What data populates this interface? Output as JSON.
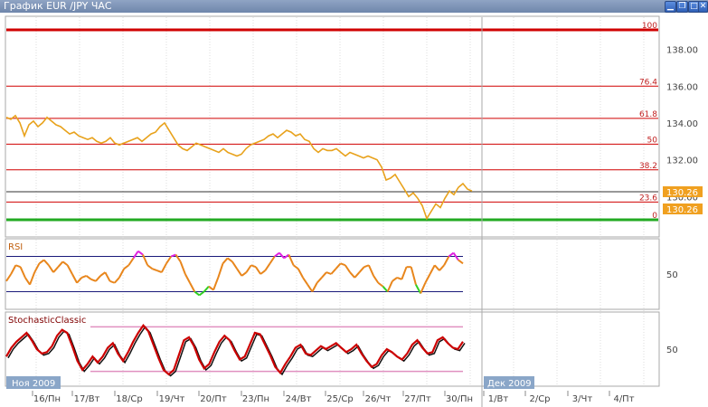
{
  "window": {
    "title": "График EUR /JPY  ЧАС",
    "buttons": [
      "minimize",
      "restore",
      "maximize",
      "close"
    ]
  },
  "colors": {
    "price_line": "#e8a21c",
    "fib_line": "#d00000",
    "fib_label": "#c02020",
    "current_price_bg": "#f0a020",
    "low_line": "#22aa22",
    "rsi_normal": "#e8861c",
    "rsi_overbought": "#e020e0",
    "rsi_oversold": "#30d020",
    "stoch_main": "#cc0000",
    "stoch_signal": "#111111",
    "stoch_band": "#e090c0",
    "rsi_band": "#1a1a7a",
    "grid": "#dddddd",
    "date_box": "#8aa6c8"
  },
  "chart_data": [
    {
      "type": "line",
      "panel": "price",
      "title": "",
      "x": [
        0,
        5,
        10,
        15,
        20,
        25,
        30,
        35,
        40,
        45,
        50,
        55,
        60,
        65,
        70,
        75,
        80,
        85,
        90,
        95,
        100,
        105,
        110,
        115,
        120,
        125,
        130,
        135,
        140,
        145,
        150,
        155,
        160,
        165,
        170,
        175,
        180,
        185,
        190,
        195,
        200,
        205,
        210,
        215,
        220,
        225,
        230,
        235,
        240,
        245,
        250,
        255,
        260,
        265,
        270,
        275,
        280,
        285,
        290,
        295,
        300,
        305,
        310,
        315,
        320,
        325,
        330,
        335,
        340,
        345,
        350,
        355,
        360,
        365,
        370,
        375,
        380,
        385,
        390,
        395,
        400,
        405,
        410,
        415,
        420,
        425,
        430,
        435,
        440,
        445,
        450,
        455,
        460,
        465,
        470,
        475,
        480,
        485,
        490,
        495,
        500,
        505,
        510,
        515
      ],
      "y": [
        134.3,
        134.2,
        134.4,
        134.0,
        133.3,
        133.9,
        134.1,
        133.8,
        134.0,
        134.3,
        134.1,
        133.9,
        133.8,
        133.6,
        133.4,
        133.5,
        133.3,
        133.2,
        133.1,
        133.2,
        133.0,
        132.9,
        133.0,
        133.2,
        132.9,
        132.8,
        132.9,
        133.0,
        133.1,
        133.2,
        133.0,
        133.2,
        133.4,
        133.5,
        133.8,
        134.0,
        133.6,
        133.2,
        132.8,
        132.6,
        132.5,
        132.7,
        132.9,
        132.8,
        132.7,
        132.6,
        132.5,
        132.4,
        132.6,
        132.4,
        132.3,
        132.2,
        132.3,
        132.6,
        132.8,
        132.9,
        133.0,
        133.1,
        133.3,
        133.4,
        133.2,
        133.4,
        133.6,
        133.5,
        133.3,
        133.4,
        133.1,
        133.0,
        132.6,
        132.4,
        132.6,
        132.5,
        132.5,
        132.6,
        132.4,
        132.2,
        132.4,
        132.3,
        132.2,
        132.1,
        132.2,
        132.1,
        132.0,
        131.6,
        130.9,
        131.0,
        131.2,
        130.8,
        130.4,
        130.0,
        130.2,
        129.9,
        129.5,
        128.8,
        129.2,
        129.6,
        129.4,
        129.9,
        130.3,
        130.1,
        130.5,
        130.7,
        130.4,
        130.3
      ],
      "ylim": [
        127.8,
        139.8
      ],
      "y_ticks": [
        "138.00",
        "136.00",
        "134.00",
        "132.00",
        "130.00"
      ],
      "fib_levels": [
        {
          "label": "100",
          "value": 138.85
        },
        {
          "label": "76.4",
          "value": 136.0
        },
        {
          "label": "61.8",
          "value": 134.25
        },
        {
          "label": "50",
          "value": 132.85
        },
        {
          "label": "38.2",
          "value": 131.45
        },
        {
          "label": "23.6",
          "value": 129.7
        },
        {
          "label": "0",
          "value": 126.85
        }
      ],
      "current_price": "130.26",
      "current_price_value": 130.26,
      "low_price_label": "130.26"
    },
    {
      "type": "line",
      "panel": "rsi",
      "title": "RSI",
      "y_ticks": [
        "50"
      ],
      "levels": [
        70,
        30
      ],
      "ylim": [
        10,
        90
      ],
      "values": [
        42,
        50,
        60,
        58,
        46,
        38,
        52,
        62,
        66,
        60,
        52,
        58,
        64,
        60,
        50,
        40,
        46,
        48,
        44,
        42,
        48,
        52,
        42,
        40,
        46,
        56,
        60,
        68,
        76,
        72,
        60,
        56,
        54,
        52,
        62,
        70,
        72,
        64,
        50,
        40,
        30,
        26,
        30,
        36,
        32,
        46,
        62,
        68,
        64,
        56,
        48,
        52,
        60,
        58,
        50,
        54,
        62,
        70,
        74,
        68,
        72,
        60,
        56,
        46,
        38,
        30,
        40,
        46,
        52,
        50,
        56,
        62,
        60,
        52,
        46,
        52,
        58,
        60,
        48,
        40,
        36,
        30,
        42,
        46,
        44,
        58,
        58,
        38,
        28,
        40,
        50,
        60,
        54,
        60,
        70,
        74,
        66,
        62
      ]
    },
    {
      "type": "line",
      "panel": "stochastic",
      "title": "StochasticClassic",
      "y_ticks": [
        "50"
      ],
      "levels": [
        80,
        20
      ],
      "ylim": [
        0,
        100
      ],
      "values": [
        40,
        52,
        60,
        66,
        72,
        62,
        50,
        44,
        46,
        54,
        68,
        76,
        72,
        54,
        34,
        22,
        30,
        40,
        32,
        40,
        52,
        58,
        44,
        34,
        46,
        60,
        72,
        82,
        74,
        56,
        38,
        22,
        16,
        22,
        42,
        62,
        66,
        54,
        36,
        24,
        30,
        46,
        60,
        68,
        62,
        48,
        36,
        40,
        56,
        72,
        70,
        56,
        42,
        26,
        18,
        30,
        40,
        52,
        56,
        44,
        42,
        48,
        54,
        50,
        54,
        58,
        52,
        46,
        50,
        56,
        44,
        34,
        26,
        30,
        42,
        50,
        46,
        40,
        36,
        44,
        56,
        62,
        52,
        44,
        46,
        62,
        66,
        58,
        52,
        50,
        60
      ]
    }
  ],
  "period_labels": [
    "Ноя 2009",
    "Дек 2009"
  ],
  "x_axis_labels": [
    "16/Пн",
    "17/Вт",
    "18/Ср",
    "19/Чт",
    "20/Пт",
    "23/Пн",
    "24/Вт",
    "25/Ср",
    "26/Чт",
    "27/Пт",
    "30/Пн",
    "1/Вт",
    "2/Ср",
    "3/Чт",
    "4/Пт"
  ]
}
